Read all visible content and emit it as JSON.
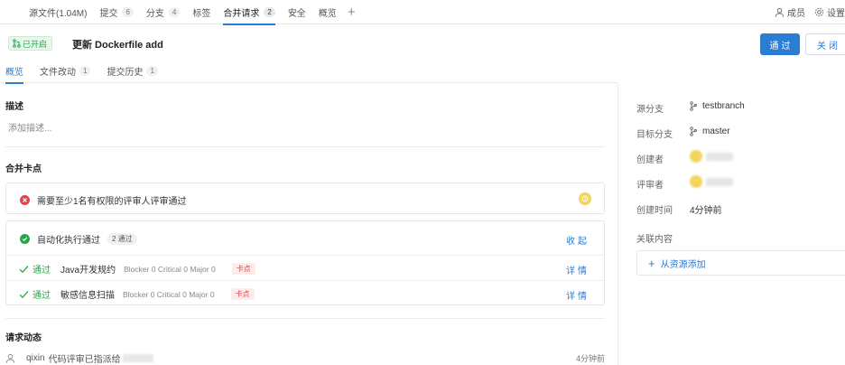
{
  "topnav": {
    "tabs": [
      {
        "label": "源文件(1.04M)",
        "count": ""
      },
      {
        "label": "提交",
        "count": "6"
      },
      {
        "label": "分支",
        "count": "4"
      },
      {
        "label": "标签",
        "count": ""
      },
      {
        "label": "合并请求",
        "count": "2"
      },
      {
        "label": "安全",
        "count": ""
      },
      {
        "label": "概览",
        "count": ""
      }
    ],
    "members_label": "成员",
    "settings_label": "设置"
  },
  "header": {
    "status_badge": "已开启",
    "title": "更新 Dockerfile add",
    "approve_label": "通过",
    "close_label": "关闭"
  },
  "subtabs": [
    {
      "label": "概览",
      "count": ""
    },
    {
      "label": "文件改动",
      "count": "1"
    },
    {
      "label": "提交历史",
      "count": "1"
    }
  ],
  "description": {
    "title": "描述",
    "placeholder": "添加描述..."
  },
  "merge_checks": {
    "title": "合并卡点",
    "review_rule": "需要至少1名有权限的评审人评审通过",
    "automation": {
      "label": "自动化执行通过",
      "count_label": "2 通过",
      "collapse_label": "收起",
      "items": [
        {
          "status": "通过",
          "name": "Java开发规约",
          "detail": "Blocker 0 Critical 0 Major 0",
          "tag": "卡点",
          "action": "详情"
        },
        {
          "status": "通过",
          "name": "敏感信息扫描",
          "detail": "Blocker 0 Critical 0 Major 0",
          "tag": "卡点",
          "action": "详情"
        }
      ]
    }
  },
  "activity": {
    "title": "请求动态",
    "entry_user": "qixin",
    "entry_text": "代码评审已指派给",
    "entry_time": "4分钟前"
  },
  "sidebar": {
    "source_branch_label": "源分支",
    "source_branch": "testbranch",
    "target_branch_label": "目标分支",
    "target_branch": "master",
    "creator_label": "创建者",
    "reviewer_label": "评审者",
    "created_time_label": "创建时间",
    "created_time": "4分钟前",
    "related_label": "关联内容",
    "add_from_resource": "从资源添加"
  },
  "colors": {
    "accent": "#2b7cd3",
    "success": "#2aa54c",
    "danger": "#e0454a"
  }
}
